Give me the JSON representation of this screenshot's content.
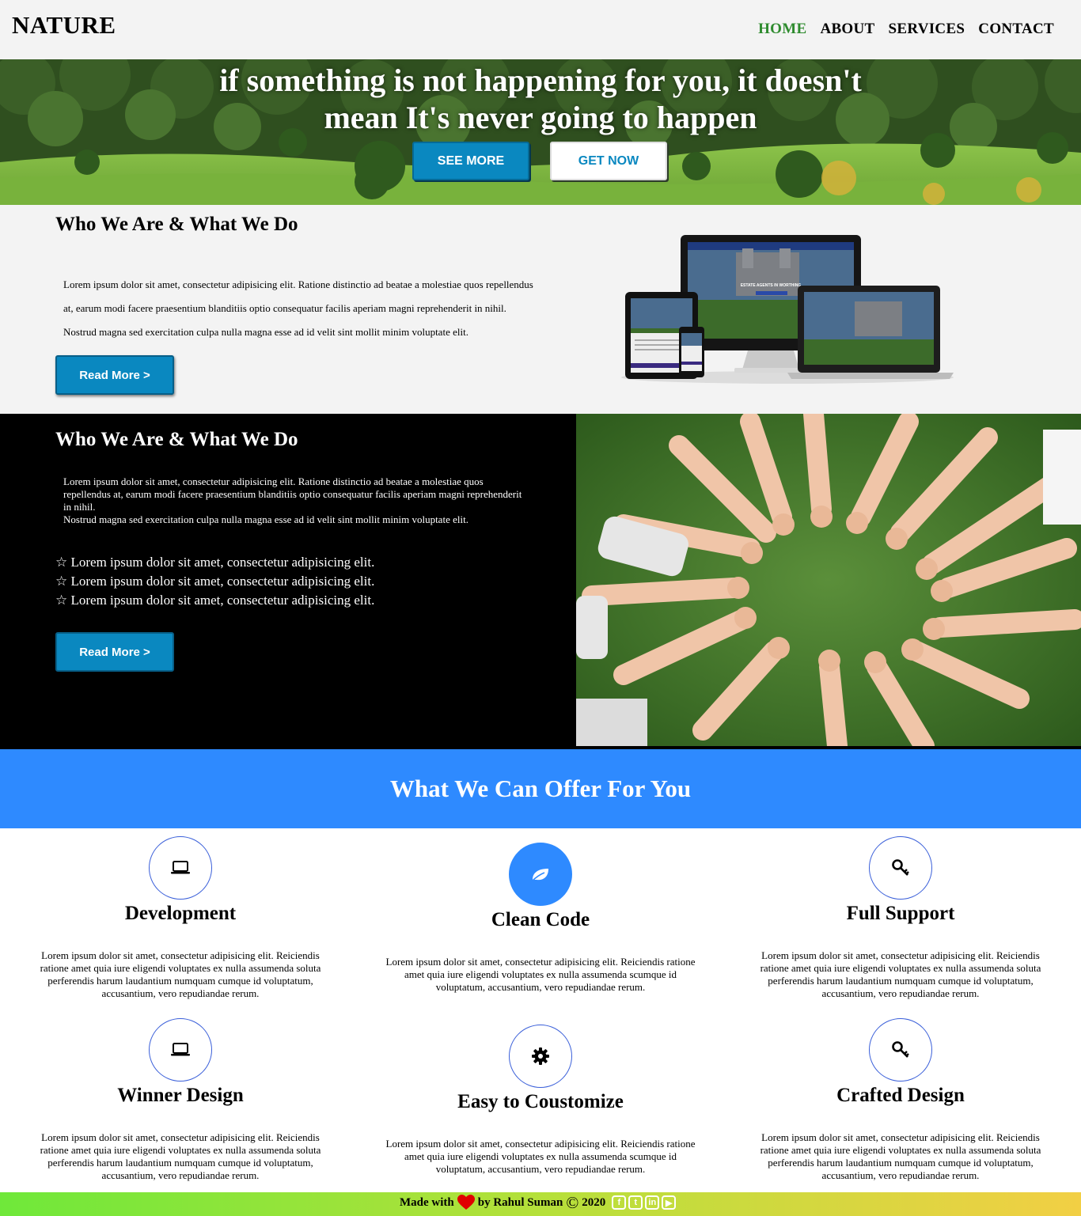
{
  "header": {
    "logo": "NATURE",
    "nav": [
      {
        "label": "HOME",
        "active": true
      },
      {
        "label": "ABOUT",
        "active": false
      },
      {
        "label": "SERVICES",
        "active": false
      },
      {
        "label": "CONTACT",
        "active": false
      }
    ]
  },
  "hero": {
    "line1": "if something is not happening for you, it doesn't",
    "line2": "mean It's never going to happen",
    "see_more": "SEE MORE",
    "get_now": "GET NOW"
  },
  "about_light": {
    "title": "Who We Are & What We Do",
    "line1": "Lorem ipsum dolor sit amet, consectetur adipisicing elit. Ratione distinctio ad beatae a molestiae quos repellendus",
    "line2": "at, earum modi facere praesentium blanditiis optio consequatur facilis aperiam magni reprehenderit in nihil.",
    "line3": "Nostrud magna sed exercitation culpa nulla magna esse ad id velit sint mollit minim voluptate elit.",
    "button": "Read More >",
    "devices_screen_text": "ESTATE AGENTS IN WORTHING"
  },
  "about_dark": {
    "title": "Who We Are & What We Do",
    "para": "Lorem ipsum dolor sit amet, consectetur adipisicing elit. Ratione distinctio ad beatae a molestiae quos repellendus at, earum modi facere praesentium blanditiis optio consequatur facilis aperiam magni reprehenderit in nihil.",
    "para2": "Nostrud magna sed exercitation culpa nulla magna esse ad id velit sint mollit minim voluptate elit.",
    "stars": [
      "☆ Lorem ipsum dolor sit amet, consectetur adipisicing elit.",
      "☆ Lorem ipsum dolor sit amet, consectetur adipisicing elit.",
      "☆ Lorem ipsum dolor sit amet, consectetur adipisicing elit."
    ],
    "button": "Read More >"
  },
  "offer": {
    "title": "What We Can Offer For You"
  },
  "features": [
    {
      "title": "Development",
      "icon": "laptop-icon",
      "text": "Lorem ipsum dolor sit amet, consectetur adipisicing elit. Reiciendis ratione amet quia iure eligendi voluptates ex nulla assumenda soluta perferendis harum laudantium numquam cumque id voluptatum, accusantium, vero repudiandae rerum."
    },
    {
      "title": "Clean Code",
      "icon": "leaf-icon",
      "text": "Lorem ipsum dolor sit amet, consectetur adipisicing elit. Reiciendis ratione amet quia iure eligendi voluptates ex nulla assumenda scumque id voluptatum, accusantium, vero repudiandae rerum."
    },
    {
      "title": "Full Support",
      "icon": "key-icon",
      "text": "Lorem ipsum dolor sit amet, consectetur adipisicing elit. Reiciendis ratione amet quia iure eligendi voluptates ex nulla assumenda soluta perferendis harum laudantium numquam cumque id voluptatum, accusantium, vero repudiandae rerum."
    },
    {
      "title": "Winner Design",
      "icon": "laptop-icon",
      "text": "Lorem ipsum dolor sit amet, consectetur adipisicing elit. Reiciendis ratione amet quia iure eligendi voluptates ex nulla assumenda soluta perferendis harum laudantium numquam cumque id voluptatum, accusantium, vero repudiandae rerum."
    },
    {
      "title": "Easy to Coustomize",
      "icon": "gear-icon",
      "text": "Lorem ipsum dolor sit amet, consectetur adipisicing elit. Reiciendis ratione amet quia iure eligendi voluptates ex nulla assumenda scumque id voluptatum, accusantium, vero repudiandae rerum."
    },
    {
      "title": "Crafted Design",
      "icon": "key-icon",
      "text": "Lorem ipsum dolor sit amet, consectetur adipisicing elit. Reiciendis ratione amet quia iure eligendi voluptates ex nulla assumenda soluta perferendis harum laudantium numquam cumque id voluptatum, accusantium, vero repudiandae rerum."
    }
  ],
  "footer": {
    "made_with": "Made with",
    "by": "by Rahul Suman",
    "copy": "©",
    "year": "2020",
    "social": [
      {
        "icon": "facebook-icon",
        "glyph": "f"
      },
      {
        "icon": "twitter-icon",
        "glyph": "t"
      },
      {
        "icon": "linkedin-icon",
        "glyph": "in"
      },
      {
        "icon": "youtube-icon",
        "glyph": "▶"
      }
    ]
  },
  "colors": {
    "accent_blue": "#0a88c0",
    "offer_blue": "#2e8aff",
    "nav_active": "#2e8b2e",
    "heart": "#e00000"
  }
}
